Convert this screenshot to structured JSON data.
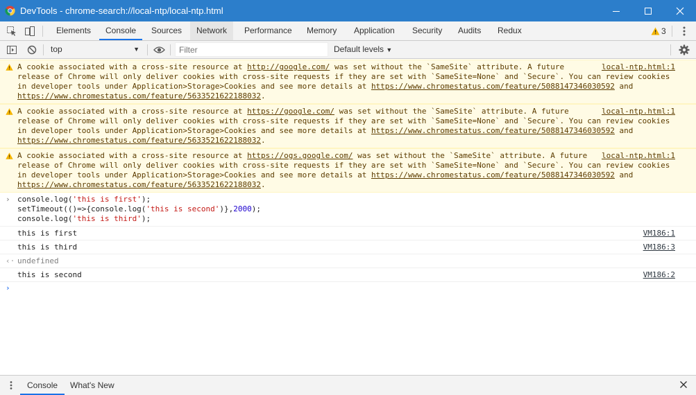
{
  "window": {
    "title": "DevTools - chrome-search://local-ntp/local-ntp.html",
    "minimize": "minimize",
    "maximize": "maximize",
    "close": "close"
  },
  "tabs": [
    {
      "label": "Elements"
    },
    {
      "label": "Console"
    },
    {
      "label": "Sources"
    },
    {
      "label": "Network"
    },
    {
      "label": "Performance"
    },
    {
      "label": "Memory"
    },
    {
      "label": "Application"
    },
    {
      "label": "Security"
    },
    {
      "label": "Audits"
    },
    {
      "label": "Redux"
    }
  ],
  "warnings_count": "3",
  "toolbar": {
    "context": "top",
    "filter_placeholder": "Filter",
    "levels": "Default levels"
  },
  "messages": {
    "w1": {
      "source": "local-ntp.html:1",
      "p1": "A cookie associated with a cross-site resource at ",
      "link1": "http://google.com/",
      "p2": " was set without the `SameSite` attribute. A future release of Chrome will only deliver cookies with cross-site requests if they are set with `SameSite=None` and `Secure`. You can review cookies in developer tools under Application>Storage>Cookies and see more details at ",
      "link2": "https://www.chromestatus.com/feature/5088147346030592",
      "p3": " and ",
      "link3": "https://www.chromestatus.com/feature/5633521622188032",
      "p4": "."
    },
    "w2": {
      "source": "local-ntp.html:1",
      "p1": "A cookie associated with a cross-site resource at ",
      "link1": "https://google.com/",
      "p2": " was set without the `SameSite` attribute. A future release of Chrome will only deliver cookies with cross-site requests if they are set with `SameSite=None` and `Secure`. You can review cookies in developer tools under Application>Storage>Cookies and see more details at ",
      "link2": "https://www.chromestatus.com/feature/5088147346030592",
      "p3": " and ",
      "link3": "https://www.chromestatus.com/feature/5633521622188032",
      "p4": "."
    },
    "w3": {
      "source": "local-ntp.html:1",
      "p1": "A cookie associated with a cross-site resource at ",
      "link1": "https://ogs.google.com/",
      "p2": " was set without the `SameSite` attribute. A future release of Chrome will only deliver cookies with cross-site requests if they are set with `SameSite=None` and `Secure`. You can review cookies in developer tools under Application>Storage>Cookies and see more details at ",
      "link2": "https://www.chromestatus.com/feature/5088147346030592",
      "p3": " and ",
      "link3": "https://www.chromestatus.com/feature/5633521622188032",
      "p4": "."
    },
    "code": {
      "l1_a": "console.log(",
      "l1_s": "'this is first'",
      "l1_b": ");",
      "l2_a": "setTimeout(()=>{console.log(",
      "l2_s": "'this is second'",
      "l2_b": ")},",
      "l2_n": "2000",
      "l2_c": ");",
      "l3_a": "console.log(",
      "l3_s": "'this is third'",
      "l3_b": ");"
    },
    "out1": {
      "text": "this is first",
      "source": "VM186:1"
    },
    "out2": {
      "text": "this is third",
      "source": "VM186:3"
    },
    "result": "undefined",
    "out3": {
      "text": "this is second",
      "source": "VM186:2"
    }
  },
  "drawer": {
    "tab1": "Console",
    "tab2": "What's New"
  },
  "colors": {
    "titlebar": "#2c7ecb",
    "accent": "#1a73e8",
    "warning_bg": "#fffbe5"
  }
}
